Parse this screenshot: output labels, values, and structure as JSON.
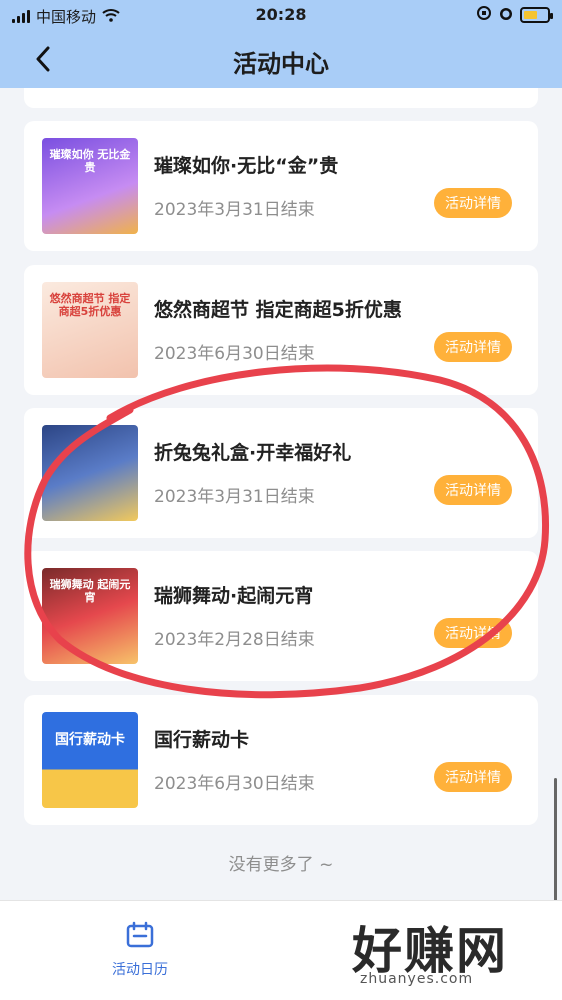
{
  "status_bar": {
    "carrier": "中国移动",
    "time": "20:28"
  },
  "header": {
    "title": "活动中心"
  },
  "activities": [
    {
      "title": "璀璨如你·无比“金”贵",
      "date": "2023年3月31日结束",
      "button": "活动详情",
      "thumb_text": "璀璨如你 无比金贵",
      "thumb_colors": [
        "#6b46d6",
        "#f1a7ff"
      ]
    },
    {
      "title": "悠然商超节 指定商超5折优惠",
      "date": "2023年6月30日结束",
      "button": "活动详情",
      "thumb_text": "悠然商超节 指定商超5折优惠",
      "thumb_colors": [
        "#f7dfcf",
        "#f2b39a"
      ]
    },
    {
      "title": "折兔兔礼盒·开幸福好礼",
      "date": "2023年3月31日结束",
      "button": "活动详情",
      "thumb_text": "",
      "thumb_colors": [
        "#304a8c",
        "#f1cc5a"
      ]
    },
    {
      "title": "瑞狮舞动·起闹元宵",
      "date": "2023年2月28日结束",
      "button": "活动详情",
      "thumb_text": "瑞狮舞动 起闹元宵",
      "thumb_colors": [
        "#e5484d",
        "#f7c36a"
      ]
    },
    {
      "title": "国行薪动卡",
      "date": "2023年6月30日结束",
      "button": "活动详情",
      "thumb_text": "国行薪动卡",
      "thumb_colors": [
        "#2f6fe0",
        "#f7c648"
      ]
    }
  ],
  "footer_text": "没有更多了 ~",
  "tabbar": {
    "calendar_label": "活动日历"
  },
  "watermark": {
    "main": "好赚网",
    "sub": "zhuanyes.com"
  },
  "colors": {
    "header_bg": "#a9cdf7",
    "button_bg": "#ffb13a",
    "tab_active": "#3a6fd8",
    "annotation": "#e8424c"
  }
}
